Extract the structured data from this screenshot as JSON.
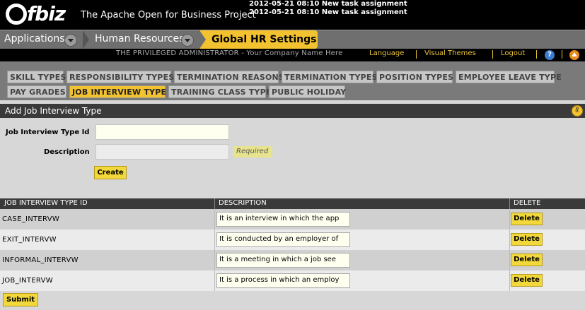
{
  "header": {
    "logo_text": "fbiz",
    "app_title": "The Apache Open for Business Project",
    "notices": [
      "2012-05-21 08:10 New task assignment",
      "2012-05-21 08:10 New task assignment"
    ]
  },
  "mainnav": {
    "applications": "Applications",
    "human_resources": "Human Resources",
    "active": "Global HR Settings"
  },
  "userbar": {
    "user": "THE PRIVILEGED ADMINISTRATOR - Your Company Name Here",
    "language": "Language",
    "visual_themes": "Visual Themes",
    "logout": "Logout",
    "help_icon": "?"
  },
  "subtabs": {
    "row1": [
      "SKILL TYPES",
      "RESPONSIBILITY TYPES",
      "TERMINATION REASONS",
      "TERMINATION TYPES",
      "POSITION TYPES",
      "EMPLOYEE LEAVE TYPE"
    ],
    "row2": [
      "PAY GRADES",
      "JOB INTERVIEW TYPE",
      "TRAINING CLASS TYPE",
      "PUBLIC HOLIDAY"
    ],
    "active": "JOB INTERVIEW TYPE"
  },
  "form": {
    "title": "Add Job Interview Type",
    "id_label": "Job Interview Type Id",
    "id_value": "",
    "desc_label": "Description",
    "desc_value": "",
    "required": "Required",
    "create": "Create"
  },
  "table": {
    "headers": [
      "JOB INTERVIEW TYPE ID",
      "DESCRIPTION",
      "DELETE"
    ],
    "rows": [
      {
        "id": "CASE_INTERVW",
        "description": "It is an interview in which the app",
        "action": "Delete"
      },
      {
        "id": "EXIT_INTERVW",
        "description": "It is conducted by an employer of",
        "action": "Delete"
      },
      {
        "id": "INFORMAL_INTERVW",
        "description": "It is a meeting in which a job see",
        "action": "Delete"
      },
      {
        "id": "JOB_INTERVW",
        "description": "It is a process in which an employ",
        "action": "Delete"
      }
    ],
    "submit": "Submit"
  },
  "colors": {
    "accent": "#f2c230",
    "header_bg": "#000000",
    "nav_bg": "#6f6f6f",
    "link": "#e8c33a"
  }
}
